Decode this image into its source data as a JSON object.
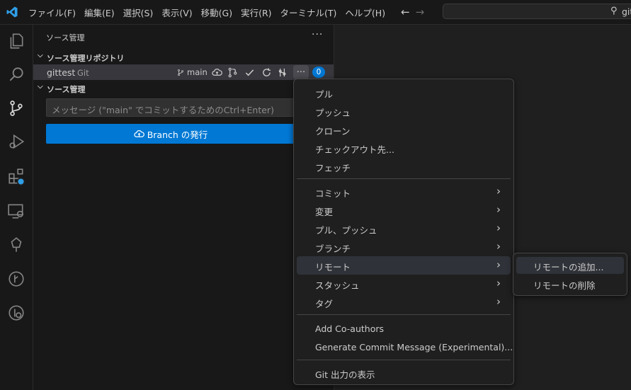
{
  "menu": {
    "items": [
      "ファイル(F)",
      "編集(E)",
      "選択(S)",
      "表示(V)",
      "移動(G)",
      "実行(R)",
      "ターミナル(T)",
      "ヘルプ(H)"
    ]
  },
  "search": {
    "text": "git"
  },
  "sidebar": {
    "title": "ソース管理",
    "more": "···",
    "repos_header": "ソース管理リポジトリ",
    "repo": {
      "name": "gittest",
      "provider": "Git",
      "branch": "main",
      "badge": "0"
    },
    "scm_header": "ソース管理",
    "commit_placeholder": "メッセージ (\"main\" でコミットするためのCtrl+Enter)",
    "publish_button": "Branch の発行"
  },
  "context_menu": {
    "items": [
      {
        "label": "プル",
        "submenu": false
      },
      {
        "label": "プッシュ",
        "submenu": false
      },
      {
        "label": "クローン",
        "submenu": false
      },
      {
        "label": "チェックアウト先...",
        "submenu": false
      },
      {
        "label": "フェッチ",
        "submenu": false
      },
      {
        "label": "コミット",
        "submenu": true
      },
      {
        "label": "変更",
        "submenu": true
      },
      {
        "label": "プル、プッシュ",
        "submenu": true
      },
      {
        "label": "ブランチ",
        "submenu": true
      },
      {
        "label": "リモート",
        "submenu": true
      },
      {
        "label": "スタッシュ",
        "submenu": true
      },
      {
        "label": "タグ",
        "submenu": true
      },
      {
        "label": "Add Co-authors",
        "submenu": false
      },
      {
        "label": "Generate Commit Message (Experimental)...",
        "submenu": false
      },
      {
        "label": "Git 出力の表示",
        "submenu": false
      }
    ],
    "highlighted": "リモート"
  },
  "submenu": {
    "items": [
      "リモートの追加...",
      "リモートの削除"
    ],
    "highlighted": "リモートの追加..."
  },
  "colors": {
    "accent": "#0078d4",
    "background": "#1f1f1f",
    "sidebar": "#181818"
  },
  "icons": [
    "vscode-logo-icon",
    "explorer-icon",
    "search-icon",
    "source-control-icon",
    "run-debug-icon",
    "extensions-icon",
    "remote-explorer-icon",
    "testing-icon",
    "git-graph-icon",
    "gitlens-icon"
  ]
}
